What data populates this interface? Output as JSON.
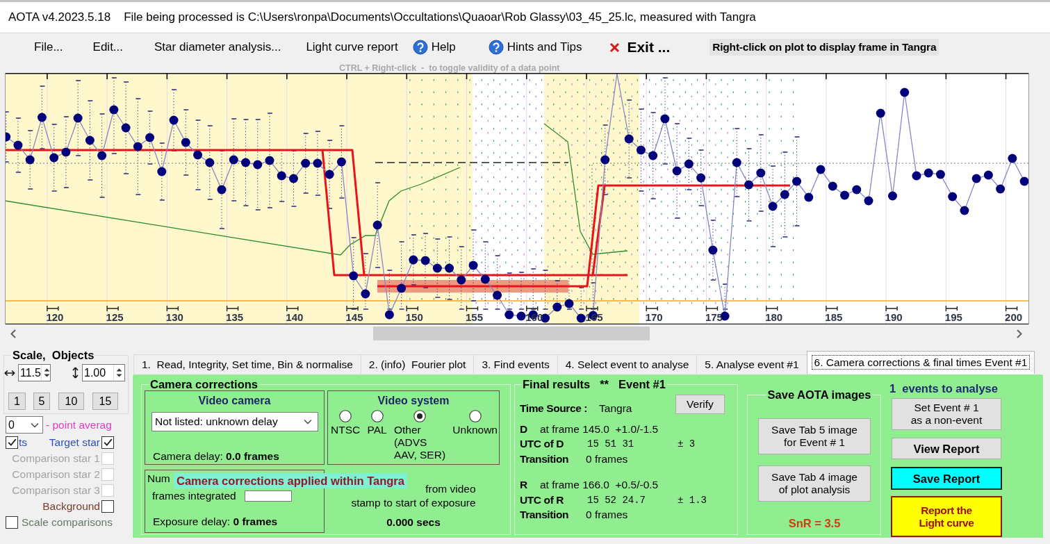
{
  "window": {
    "title": "AOTA v4.2023.5.18",
    "file_info": "File being processed is C:\\Users\\ronpa\\Documents\\Occultations\\Quaoar\\Rob Glassy\\03_45_25.lc, measured with Tangra"
  },
  "menu": {
    "items": [
      {
        "label": "File...",
        "kind": "menu"
      },
      {
        "label": "Edit...",
        "kind": "menu"
      },
      {
        "label": "Star diameter analysis...",
        "kind": "menu"
      },
      {
        "label": "Light curve report",
        "kind": "menu"
      },
      {
        "label": "Help",
        "kind": "help"
      },
      {
        "label": "Hints and Tips",
        "kind": "help"
      },
      {
        "label": "Exit ...",
        "kind": "exit"
      }
    ],
    "plot_hint": "Right-click on plot to display frame in Tangra",
    "toggle_hint": "CTRL + Right-click  -  to toggle validity of a data point"
  },
  "plot": {
    "x_tick_labels": [
      "120",
      "125",
      "130",
      "135",
      "140",
      "145",
      "150",
      "155",
      "160",
      "165",
      "170",
      "175",
      "180",
      "185",
      "190",
      "195",
      "200"
    ]
  },
  "side_panel": {
    "title": "Scale,  Objects",
    "horizontal_scale": "11.5",
    "vertical_scale": "1.00",
    "scale_buttons": [
      "1",
      "5",
      "10",
      "15"
    ],
    "point_average": "0",
    "point_average_label": "- point averag",
    "plots_toggle": {
      "label": "ts",
      "checked": true
    },
    "objects": [
      {
        "label": "Target star",
        "checked": true,
        "disabled": false,
        "color": "#2f4fb8"
      },
      {
        "label": "Comparison star 1",
        "checked": false,
        "disabled": true
      },
      {
        "label": "Comparison star 2",
        "checked": false,
        "disabled": true
      },
      {
        "label": "Comparison star 3",
        "checked": false,
        "disabled": true
      },
      {
        "label": "Background",
        "checked": false,
        "disabled": false,
        "color": "#7b3b2b"
      }
    ],
    "scale_comparisons": {
      "label": "Scale comparisons",
      "checked": false
    }
  },
  "tabs": [
    {
      "label": "1.  Read, Integrity, Set time, Bin & normalise",
      "selected": false
    },
    {
      "label": "2. (info)  Fourier plot",
      "selected": false
    },
    {
      "label": "3. Find events",
      "selected": false
    },
    {
      "label": "4. Select event to analyse",
      "selected": false
    },
    {
      "label": "5. Analyse event #1",
      "selected": false
    },
    {
      "label": "6. Camera corrections & final times Event #1",
      "selected": true
    }
  ],
  "camera_corrections": {
    "title": "Camera corrections",
    "video_camera": {
      "title": "Video camera",
      "selection": "Not listed: unknown delay",
      "delay": "Camera delay: **0.0 frames**"
    },
    "video_system": {
      "title": "Video system",
      "options": [
        {
          "label": "NTSC",
          "selected": false
        },
        {
          "label": "PAL",
          "selected": false
        },
        {
          "label": "Other\n(ADVS\nAAV, SER)",
          "selected": true
        },
        {
          "label": "Unknown",
          "selected": false
        }
      ]
    },
    "integration": {
      "label_start": "Num",
      "label_end": "frames integrated",
      "exposure_delay": "Exposure delay: **0 frames**"
    },
    "time_delay": {
      "line_1": "from video",
      "line_2": "stamp to start of exposure",
      "value": "0.000 secs"
    },
    "notice": "Camera corrections applied within Tangra"
  },
  "final_results": {
    "title": "Final results",
    "marker": "**",
    "event": "Event #1",
    "time_source_label": "Time Source :",
    "time_source": "Tangra",
    "verify": "Verify",
    "events": [
      {
        "letter": "D",
        "frame": "at frame 145.0  +1.0/-1.5",
        "utc_label": "UTC of D",
        "utc": "15 51 31",
        "error": "± 3",
        "transition_label": "Transition",
        "transition": "0 frames"
      },
      {
        "letter": "R",
        "frame": "at frame 166.0  +0.5/-0.5",
        "utc_label": "UTC of R",
        "utc": "15 52 24.7",
        "error": "± 1.3",
        "transition_label": "Transition",
        "transition": "0 frames"
      }
    ]
  },
  "save_images": {
    "title": "Save AOTA images",
    "buttons": [
      "Save Tab 5 image\nfor Event # 1",
      "Save Tab 4 image\nof plot analysis"
    ],
    "snr": "SnR = 3.5"
  },
  "event_actions": {
    "count": "1  events to analyse",
    "buttons": [
      {
        "label": "Set Event # 1\nas a non-event",
        "kind": "normal"
      },
      {
        "label": "View Report",
        "kind": "bold"
      },
      {
        "label": "Save Report",
        "kind": "highlight"
      },
      {
        "label": "Report the\nLight curve",
        "kind": "primary"
      }
    ]
  }
}
